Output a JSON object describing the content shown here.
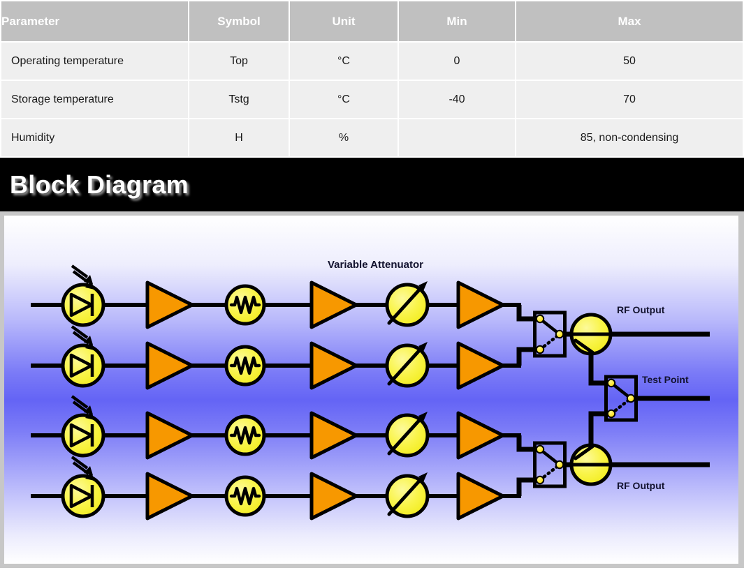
{
  "spec_table": {
    "columns": [
      "Parameter",
      "Symbol",
      "Unit",
      "Min",
      "Max"
    ],
    "rows": [
      {
        "parameter": "Operating temperature",
        "symbol": "Top",
        "unit": "°C",
        "min": "0",
        "max": "50"
      },
      {
        "parameter": "Storage temperature",
        "symbol": "Tstg",
        "unit": "°C",
        "min": "-40",
        "max": "70"
      },
      {
        "parameter": "Humidity",
        "symbol": "H",
        "unit": "%",
        "min": "",
        "max": "85, non-condensing"
      }
    ]
  },
  "block_diagram": {
    "title": "Block Diagram",
    "labels": {
      "variable_attenuator": "Variable Attenuator",
      "rf_output_top": "RF Output",
      "test_point": "Test Point",
      "rf_output_bottom": "RF Output"
    },
    "colors": {
      "amplifier_fill": "#F79800",
      "device_fill": "#FAF54B",
      "node_dot": "#FFE000",
      "wire": "#000000",
      "background_blue": "#6464F5",
      "background_edge": "#FFFFFF",
      "label_text": "#12122E",
      "title_bar": "#000000",
      "header_gray": "#C0C0C0",
      "cell_gray": "#EFEFEF"
    },
    "channels": [
      {
        "name": "channel-1",
        "components": [
          "photodiode",
          "amplifier",
          "filter",
          "amplifier",
          "variable-attenuator",
          "amplifier"
        ]
      },
      {
        "name": "channel-2",
        "components": [
          "photodiode",
          "amplifier",
          "filter",
          "amplifier",
          "variable-attenuator",
          "amplifier"
        ]
      },
      {
        "name": "channel-3",
        "components": [
          "photodiode",
          "amplifier",
          "filter",
          "amplifier",
          "variable-attenuator",
          "amplifier"
        ]
      },
      {
        "name": "channel-4",
        "components": [
          "photodiode",
          "amplifier",
          "filter",
          "amplifier",
          "variable-attenuator",
          "amplifier"
        ]
      }
    ],
    "outputs": [
      "switch",
      "splitter",
      "switch",
      "splitter",
      "switch"
    ]
  }
}
